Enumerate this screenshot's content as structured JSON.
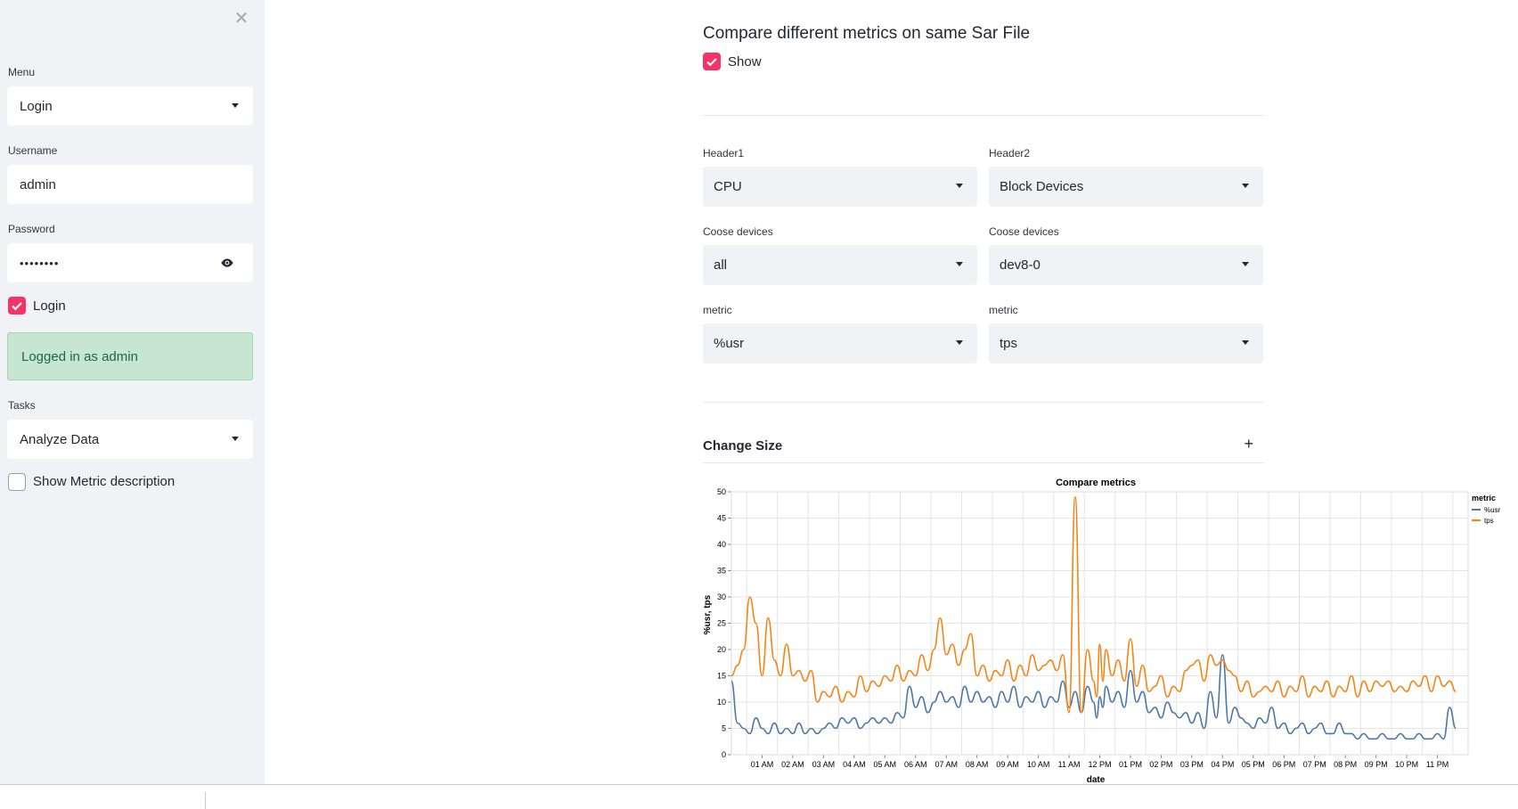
{
  "sidebar": {
    "menu_label": "Menu",
    "menu_value": "Login",
    "username_label": "Username",
    "username_value": "admin",
    "password_label": "Password",
    "password_value": "••••••••",
    "login_checkbox_label": "Login",
    "success_message": "Logged in as admin",
    "tasks_label": "Tasks",
    "tasks_value": "Analyze Data",
    "metric_desc_label": "Show Metric description"
  },
  "main": {
    "title": "Compare different metrics on same Sar File",
    "show_label": "Show",
    "header1_label": "Header1",
    "header1_value": "CPU",
    "header2_label": "Header2",
    "header2_value": "Block Devices",
    "devices1_label": "Coose devices",
    "devices1_value": "all",
    "devices2_label": "Coose devices",
    "devices2_value": "dev8-0",
    "metric1_label": "metric",
    "metric1_value": "%usr",
    "metric2_label": "metric",
    "metric2_value": "tps",
    "expander_title": "Change Size",
    "expander_icon": "+"
  },
  "colors": {
    "accent": "#f63366",
    "usr": "#4c78a8",
    "tps": "#f58518"
  },
  "chart_data": {
    "type": "line",
    "title": "Compare metrics",
    "xlabel": "date",
    "ylabel": "%usr, tps",
    "ylim": [
      0,
      50
    ],
    "yticks": [
      0,
      5,
      10,
      15,
      20,
      25,
      30,
      35,
      40,
      45,
      50
    ],
    "xtick_labels": [
      "01 AM",
      "02 AM",
      "03 AM",
      "04 AM",
      "05 AM",
      "06 AM",
      "07 AM",
      "08 AM",
      "09 AM",
      "10 AM",
      "11 AM",
      "12 PM",
      "01 PM",
      "02 PM",
      "03 PM",
      "04 PM",
      "05 PM",
      "06 PM",
      "07 PM",
      "08 PM",
      "09 PM",
      "10 PM",
      "11 PM"
    ],
    "x_hours": [
      0.0,
      0.2,
      0.4,
      0.6,
      0.8,
      1.0,
      1.2,
      1.4,
      1.6,
      1.8,
      2.0,
      2.2,
      2.4,
      2.6,
      2.8,
      3.0,
      3.2,
      3.4,
      3.6,
      3.8,
      4.0,
      4.2,
      4.4,
      4.6,
      4.8,
      5.0,
      5.2,
      5.4,
      5.6,
      5.8,
      6.0,
      6.2,
      6.4,
      6.6,
      6.8,
      7.0,
      7.2,
      7.4,
      7.6,
      7.8,
      8.0,
      8.2,
      8.4,
      8.6,
      8.8,
      9.0,
      9.2,
      9.4,
      9.6,
      9.8,
      10.0,
      10.2,
      10.4,
      10.6,
      10.8,
      11.0,
      11.2,
      11.4,
      11.6,
      11.8,
      11.9,
      12.0,
      12.1,
      12.2,
      12.4,
      12.6,
      12.8,
      13.0,
      13.2,
      13.4,
      13.6,
      13.8,
      14.0,
      14.2,
      14.4,
      14.6,
      14.8,
      15.0,
      15.2,
      15.4,
      15.6,
      15.8,
      16.0,
      16.2,
      16.4,
      16.6,
      16.8,
      17.0,
      17.2,
      17.4,
      17.6,
      17.8,
      18.0,
      18.2,
      18.4,
      18.6,
      18.8,
      19.0,
      19.2,
      19.4,
      19.6,
      19.8,
      20.0,
      20.2,
      20.4,
      20.6,
      20.8,
      21.0,
      21.2,
      21.4,
      21.6,
      21.8,
      22.0,
      22.2,
      22.4,
      22.6,
      22.8,
      23.0,
      23.2,
      23.4,
      23.6,
      23.8
    ],
    "legend_title": "metric",
    "legend_position": "top-right",
    "series": [
      {
        "name": "%usr",
        "values": [
          14,
          6,
          5,
          4,
          7,
          5,
          4,
          6,
          4,
          5,
          4,
          6,
          4,
          5,
          4,
          5,
          6,
          5,
          7,
          6,
          7,
          5,
          6,
          7,
          6,
          7,
          6,
          8,
          7,
          13,
          9,
          11,
          8,
          10,
          12,
          10,
          11,
          9,
          13,
          10,
          12,
          10,
          11,
          9,
          12,
          10,
          13,
          9,
          11,
          10,
          12,
          9,
          11,
          10,
          14,
          9,
          12,
          8,
          13,
          10,
          7,
          11,
          9,
          13,
          10,
          12,
          9,
          16,
          10,
          12,
          8,
          9,
          7,
          10,
          8,
          7,
          8,
          6,
          8,
          5,
          12,
          7,
          19,
          6,
          9,
          7,
          6,
          5,
          7,
          6,
          9,
          5,
          6,
          4,
          5,
          6,
          4,
          5,
          6,
          4,
          4,
          6,
          4,
          4,
          3,
          4,
          3,
          3,
          4,
          3,
          3,
          4,
          3,
          3,
          4,
          3,
          3,
          4,
          3,
          9,
          5
        ]
      },
      {
        "name": "tps",
        "values": [
          15,
          17,
          20,
          30,
          25,
          15,
          26,
          18,
          15,
          21,
          15,
          16,
          14,
          16,
          10,
          12,
          11,
          13,
          10,
          12,
          11,
          15,
          12,
          14,
          13,
          15,
          14,
          17,
          14,
          16,
          15,
          19,
          16,
          20,
          26,
          19,
          21,
          17,
          20,
          23,
          15,
          17,
          14,
          16,
          15,
          18,
          14,
          17,
          15,
          19,
          16,
          17,
          18,
          16,
          19,
          8,
          49,
          8,
          20,
          14,
          11,
          21,
          14,
          20,
          15,
          18,
          14,
          22,
          13,
          17,
          12,
          13,
          15,
          11,
          13,
          12,
          16,
          17,
          18,
          14,
          19,
          17,
          18,
          16,
          15,
          12,
          14,
          11,
          12,
          13,
          12,
          14,
          11,
          13,
          12,
          15,
          11,
          13,
          12,
          14,
          11,
          13,
          12,
          15,
          11,
          14,
          12,
          14,
          13,
          14,
          12,
          13,
          12,
          14,
          13,
          15,
          12,
          15,
          13,
          14,
          12
        ]
      }
    ]
  }
}
